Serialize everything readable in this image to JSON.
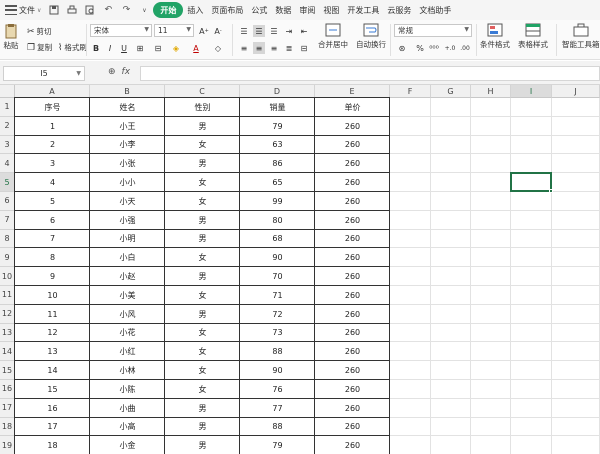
{
  "menubar": {
    "file_label": "文件",
    "tabs": [
      {
        "label": "开始",
        "active": true
      },
      {
        "label": "插入",
        "active": false
      },
      {
        "label": "页面布局",
        "active": false
      },
      {
        "label": "公式",
        "active": false
      },
      {
        "label": "数据",
        "active": false
      },
      {
        "label": "审阅",
        "active": false
      },
      {
        "label": "视图",
        "active": false
      },
      {
        "label": "开发工具",
        "active": false
      },
      {
        "label": "云服务",
        "active": false
      },
      {
        "label": "文档助手",
        "active": false
      }
    ]
  },
  "ribbon": {
    "cut": "剪切",
    "paste": "粘贴",
    "copy": "复制",
    "format_painter": "格式刷",
    "font_name": "宋体",
    "font_size": "11",
    "merge_center": "合并居中",
    "wrap_text": "自动换行",
    "number_format": "常规",
    "conditional_format": "条件格式",
    "table_style": "表格样式",
    "smart_tools": "智能工具箱"
  },
  "formula_bar": {
    "name_box": "I5",
    "fx": "fx",
    "value": ""
  },
  "sheet": {
    "columns": [
      "A",
      "B",
      "C",
      "D",
      "E",
      "F",
      "G",
      "H",
      "I",
      "J"
    ],
    "rows": [
      "1",
      "2",
      "3",
      "4",
      "5",
      "6",
      "7",
      "8",
      "9",
      "10",
      "11",
      "12",
      "13",
      "14",
      "15",
      "16",
      "17",
      "18",
      "19"
    ],
    "selected_column": "I",
    "selected_row": "5",
    "headers": [
      "序号",
      "姓名",
      "性别",
      "销量",
      "单价"
    ],
    "data": [
      [
        "1",
        "小王",
        "男",
        "79",
        "260"
      ],
      [
        "2",
        "小李",
        "女",
        "63",
        "260"
      ],
      [
        "3",
        "小张",
        "男",
        "86",
        "260"
      ],
      [
        "4",
        "小小",
        "女",
        "65",
        "260"
      ],
      [
        "5",
        "小天",
        "女",
        "99",
        "260"
      ],
      [
        "6",
        "小强",
        "男",
        "80",
        "260"
      ],
      [
        "7",
        "小明",
        "男",
        "68",
        "260"
      ],
      [
        "8",
        "小白",
        "女",
        "90",
        "260"
      ],
      [
        "9",
        "小赵",
        "男",
        "70",
        "260"
      ],
      [
        "10",
        "小美",
        "女",
        "71",
        "260"
      ],
      [
        "11",
        "小风",
        "男",
        "72",
        "260"
      ],
      [
        "12",
        "小花",
        "女",
        "73",
        "260"
      ],
      [
        "13",
        "小红",
        "女",
        "88",
        "260"
      ],
      [
        "14",
        "小林",
        "女",
        "90",
        "260"
      ],
      [
        "15",
        "小陈",
        "女",
        "76",
        "260"
      ],
      [
        "16",
        "小曲",
        "男",
        "77",
        "260"
      ],
      [
        "17",
        "小高",
        "男",
        "88",
        "260"
      ],
      [
        "18",
        "小金",
        "男",
        "79",
        "260"
      ]
    ]
  },
  "colors": {
    "accent": "#21a366",
    "selection": "#217346"
  }
}
